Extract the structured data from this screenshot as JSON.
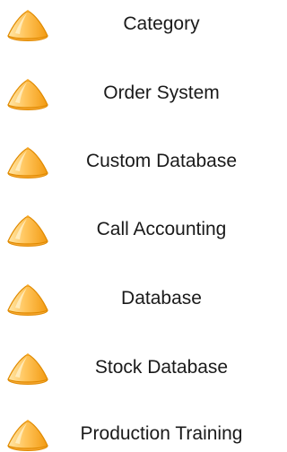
{
  "menu": {
    "items": [
      {
        "label": "Category",
        "icon": "orange-cone-icon"
      },
      {
        "label": "Order System",
        "icon": "orange-cone-icon"
      },
      {
        "label": "Custom Database",
        "icon": "orange-cone-icon"
      },
      {
        "label": "Call Accounting",
        "icon": "orange-cone-icon"
      },
      {
        "label": "Database",
        "icon": "orange-cone-icon"
      },
      {
        "label": "Stock Database",
        "icon": "orange-cone-icon"
      },
      {
        "label": "Production Training",
        "icon": "orange-cone-icon"
      }
    ]
  },
  "colors": {
    "icon_fill_light": "#ffd37a",
    "icon_fill_dark": "#f5a21c",
    "icon_outline": "#e08a00",
    "text": "#1a1a1a",
    "background": "#ffffff"
  }
}
